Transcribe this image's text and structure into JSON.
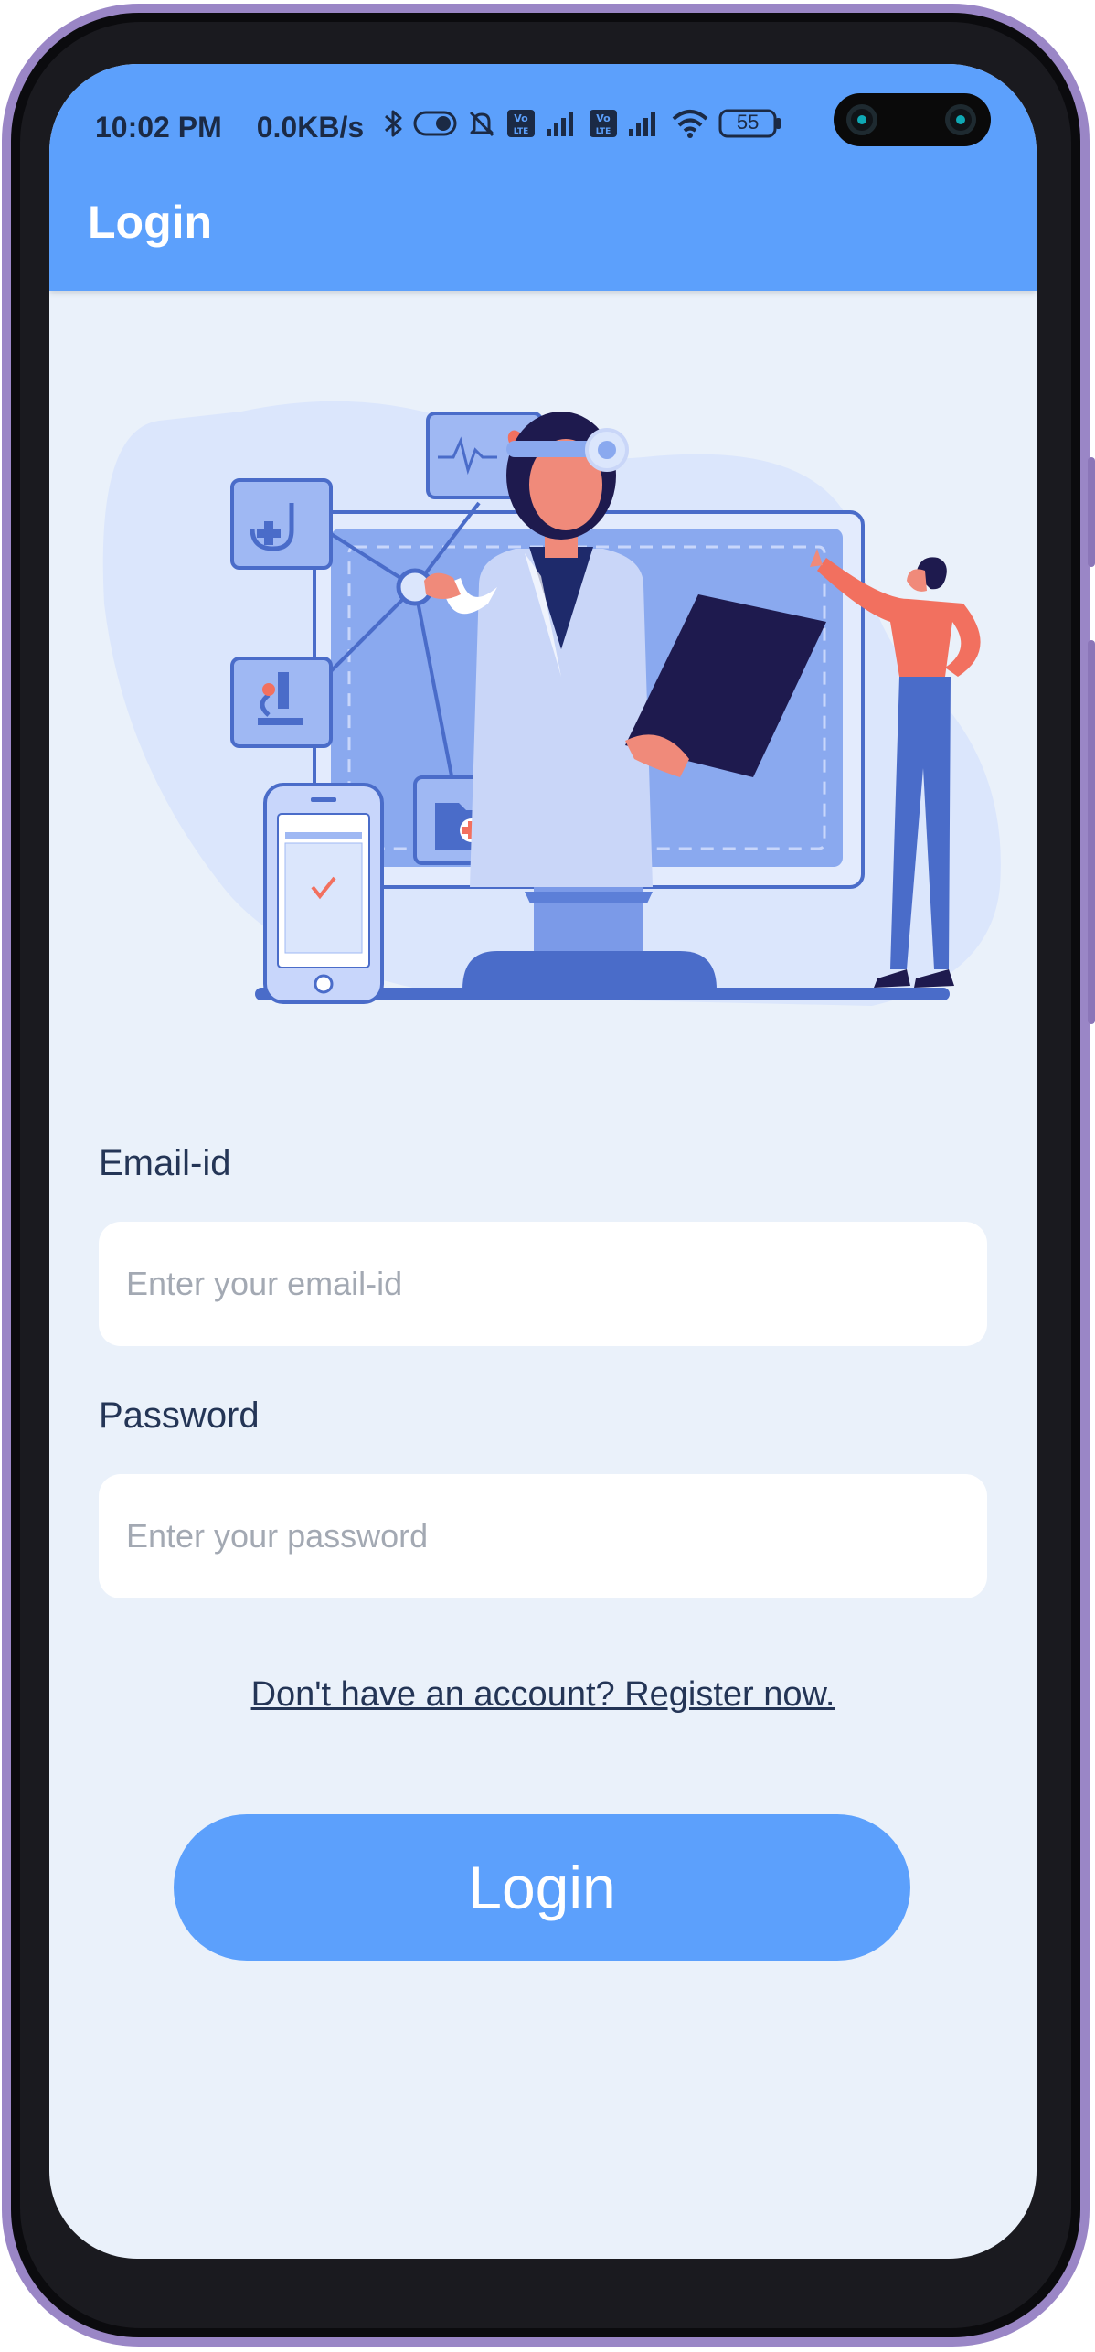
{
  "status_bar": {
    "time": "10:02 PM",
    "network_rate": "0.0KB/s",
    "battery_level": "55"
  },
  "app_bar": {
    "title": "Login"
  },
  "form": {
    "email_label": "Email-id",
    "email_placeholder": "Enter your email-id",
    "email_value": "",
    "password_label": "Password",
    "password_placeholder": "Enter your password",
    "password_value": "",
    "register_link": "Don't have an account? Register now.",
    "login_button": "Login"
  },
  "icons": [
    "bluetooth-icon",
    "toggle-icon",
    "mute-bell-icon",
    "volte-icon",
    "signal-icon",
    "wifi-icon",
    "battery-icon"
  ],
  "colors": {
    "primary": "#5ca0fc",
    "background": "#eaf1fa",
    "text": "#243556",
    "placeholder": "#a3a9b3"
  }
}
